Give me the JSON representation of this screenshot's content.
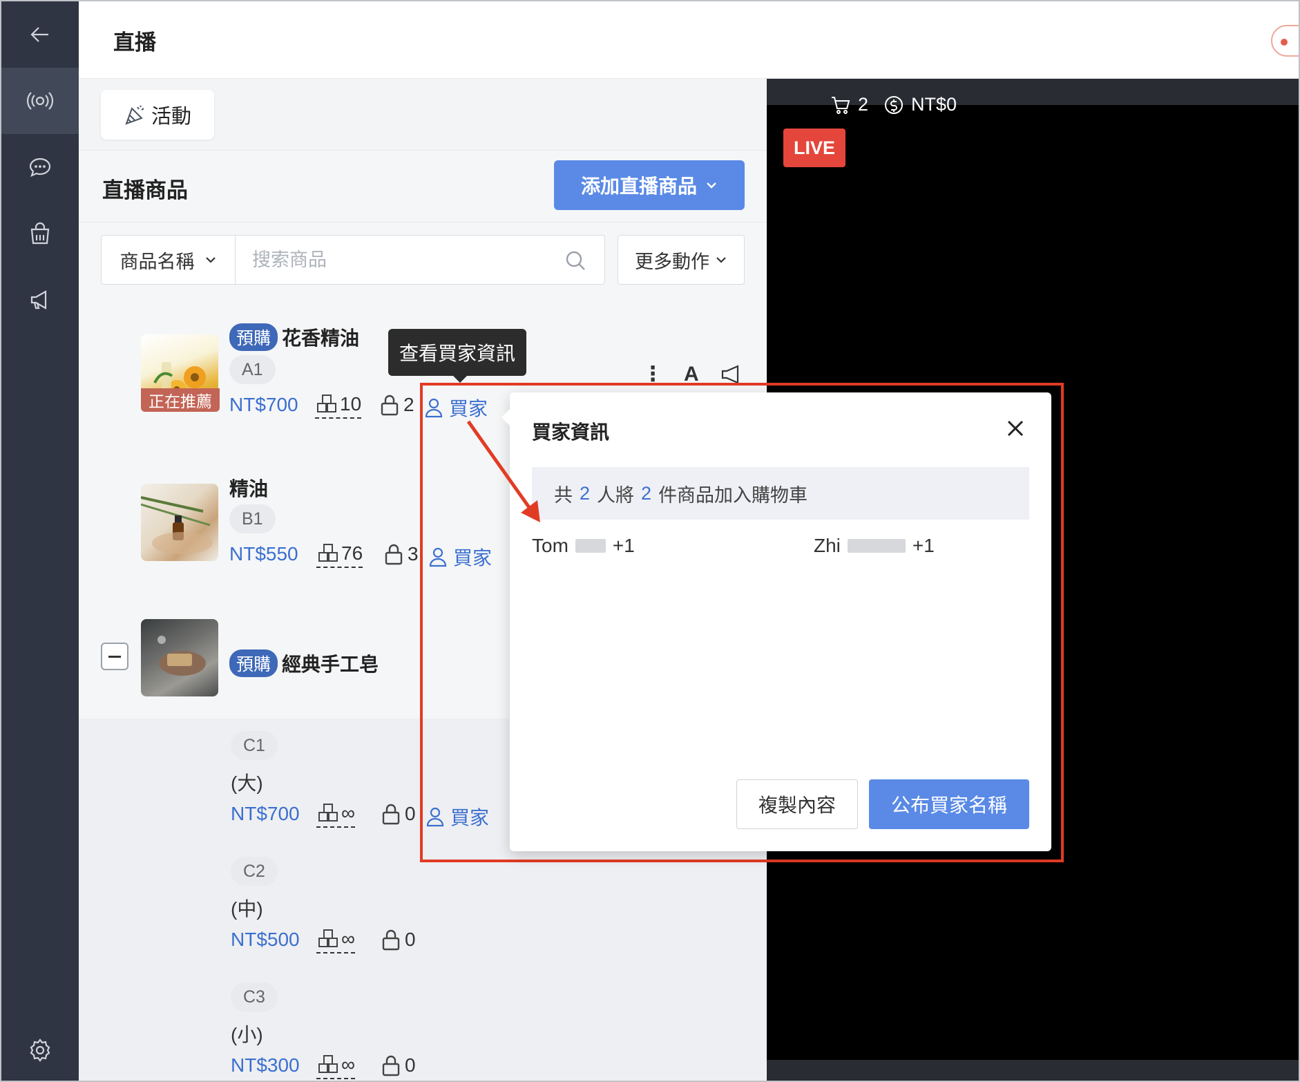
{
  "header": {
    "title": "直播"
  },
  "sidebar": {
    "icons": [
      "back-arrow-icon",
      "live-icon",
      "chat-icon",
      "shop-icon",
      "megaphone-icon",
      "settings-icon"
    ]
  },
  "activity": {
    "label": "活動"
  },
  "section": {
    "title": "直播商品",
    "add_label": "添加直播商品"
  },
  "filter": {
    "select_label": "商品名稱",
    "placeholder": "搜索商品",
    "more_label": "更多動作"
  },
  "products": [
    {
      "tag": "預購",
      "name": "花香精油",
      "code": "A1",
      "badge": "正在推薦",
      "price": "NT$700",
      "stock": "10",
      "locked": "2",
      "buyer_label": "買家"
    },
    {
      "name": "精油",
      "code": "B1",
      "price": "NT$550",
      "stock": "76",
      "locked": "3",
      "buyer_label": "買家"
    },
    {
      "tag": "預購",
      "name": "經典手工皂"
    }
  ],
  "variants": [
    {
      "code": "C1",
      "size": "(大)",
      "price": "NT$700",
      "stock": "∞",
      "locked": "0",
      "buyer_label": "買家"
    },
    {
      "code": "C2",
      "size": "(中)",
      "price": "NT$500",
      "stock": "∞",
      "locked": "0"
    },
    {
      "code": "C3",
      "size": "(小)",
      "price": "NT$300",
      "stock": "∞",
      "locked": "0"
    }
  ],
  "row_icon_text": "A",
  "tooltip": {
    "text": "查看買家資訊"
  },
  "live": {
    "cart_count": "2",
    "amount": "NT$0",
    "badge": "LIVE"
  },
  "popup": {
    "title": "買家資訊",
    "summary_prefix": "共",
    "summary_people": "2",
    "summary_mid": "人將",
    "summary_items": "2",
    "summary_suffix": "件商品加入購物車",
    "buyers": [
      {
        "name": "Tom",
        "qty": "+1"
      },
      {
        "name": "Zhi",
        "qty": "+1"
      }
    ],
    "copy_label": "複製內容",
    "publish_label": "公布買家名稱"
  },
  "colors": {
    "accent": "#5a8ae6",
    "link": "#3b6fd0",
    "live": "#e4463b",
    "annotation": "#e23b24",
    "sidebar": "#2f3542"
  }
}
